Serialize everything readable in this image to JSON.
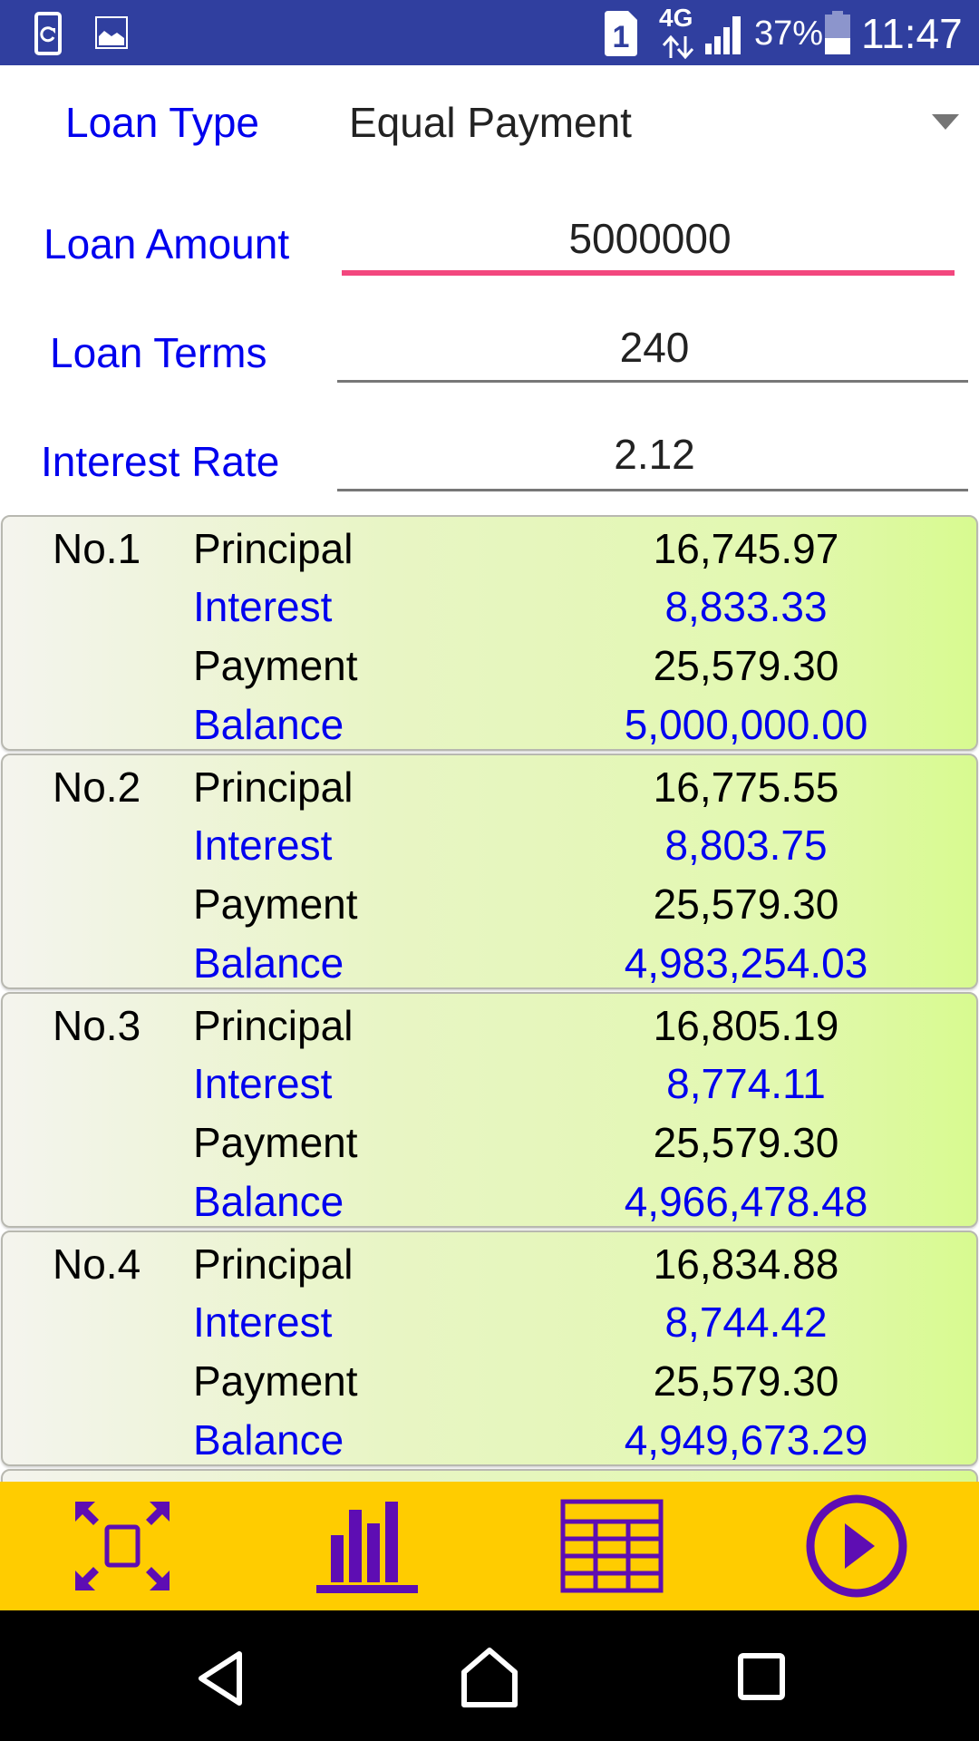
{
  "status_bar": {
    "left_icons": [
      "screen-rotation-icon",
      "image-icon"
    ],
    "sim_slot": "1",
    "network": "4G",
    "battery_percent": "37%",
    "battery_level": 0.37,
    "time": "11:47"
  },
  "form": {
    "loan_type": {
      "label": "Loan Type",
      "value": "Equal Payment"
    },
    "loan_amount": {
      "label": "Loan Amount",
      "value": "5000000"
    },
    "loan_terms": {
      "label": "Loan Terms",
      "value": "240"
    },
    "interest_rate": {
      "label": "Interest Rate",
      "value": "2.12"
    }
  },
  "row_labels": {
    "principal": "Principal",
    "interest": "Interest",
    "payment": "Payment",
    "balance": "Balance"
  },
  "schedule": [
    {
      "no": "No.1",
      "principal": "16,745.97",
      "interest": "8,833.33",
      "payment": "25,579.30",
      "balance": "5,000,000.00"
    },
    {
      "no": "No.2",
      "principal": "16,775.55",
      "interest": "8,803.75",
      "payment": "25,579.30",
      "balance": "4,983,254.03"
    },
    {
      "no": "No.3",
      "principal": "16,805.19",
      "interest": "8,774.11",
      "payment": "25,579.30",
      "balance": "4,966,478.48"
    },
    {
      "no": "No.4",
      "principal": "16,834.88",
      "interest": "8,744.42",
      "payment": "25,579.30",
      "balance": "4,949,673.29"
    }
  ],
  "toolbar": {
    "buttons": [
      "fullscreen-icon",
      "bar-chart-icon",
      "table-icon",
      "play-icon"
    ],
    "color_background": "#ffcc00",
    "color_icon": "#5e0db3"
  },
  "nav_bar": {
    "buttons": [
      "back-icon",
      "home-icon",
      "recents-icon"
    ]
  },
  "colors": {
    "status_bar": "#303f9f",
    "label_blue": "#0000ee",
    "focus_underline": "#f3477e"
  }
}
